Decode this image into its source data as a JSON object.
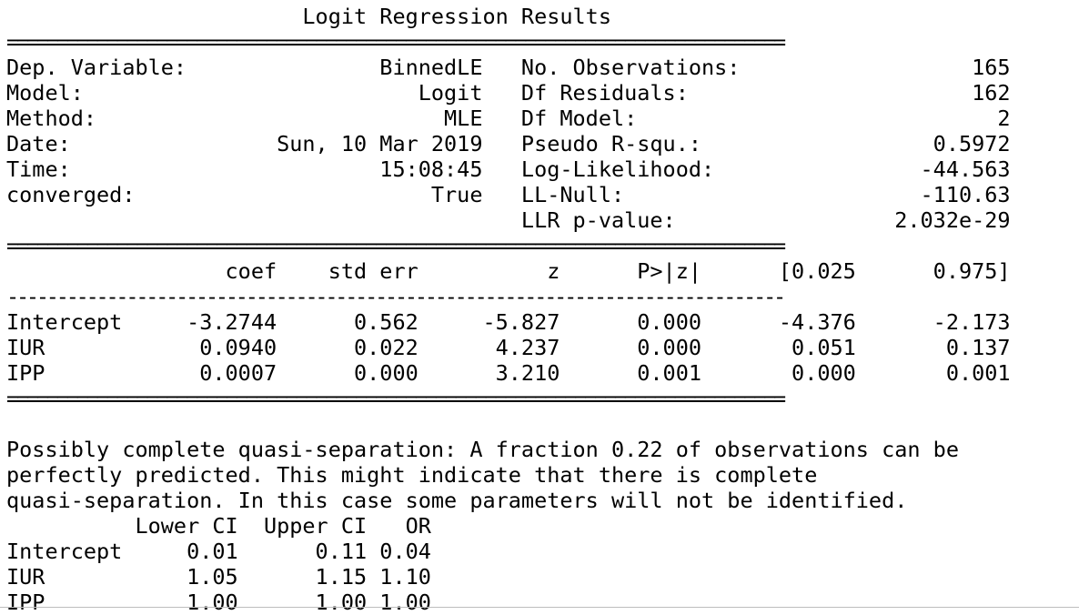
{
  "output_lines": [
    "                       Logit Regression Results",
    "==============================================================================",
    "Dep. Variable:               BinnedLE   No. Observations:                  165",
    "Model:                          Logit   Df Residuals:                      162",
    "Method:                           MLE   Df Model:                            2",
    "Date:                Sun, 10 Mar 2019   Pseudo R-squ.:                  0.5972",
    "Time:                        15:08:45   Log-Likelihood:                -44.563",
    "converged:                       True   LL-Null:                       -110.63",
    "                                        LLR p-value:                 2.032e-29",
    "==============================================================================",
    "                 coef    std err          z      P>|z|      [0.025      0.975]",
    "------------------------------------------------------------------------------",
    "Intercept     -3.2744      0.562     -5.827      0.000      -4.376      -2.173",
    "IUR            0.0940      0.022      4.237      0.000       0.051       0.137",
    "IPP            0.0007      0.000      3.210      0.001       0.000       0.001",
    "==============================================================================",
    "",
    "Possibly complete quasi-separation: A fraction 0.22 of observations can be",
    "perfectly predicted. This might indicate that there is complete",
    "quasi-separation. In this case some parameters will not be identified.",
    "          Lower CI  Upper CI   OR",
    "Intercept     0.01      0.11 0.04",
    "IUR           1.05      1.15 1.10",
    "IPP           1.00      1.00 1.00"
  ]
}
